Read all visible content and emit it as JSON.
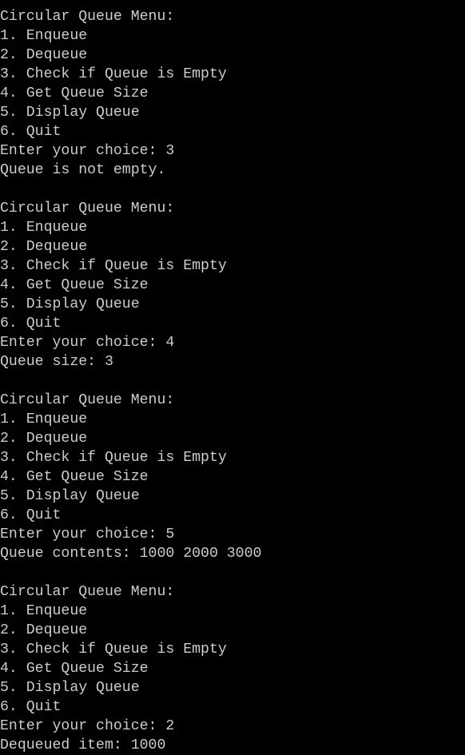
{
  "window": {
    "colors": {
      "background": "#000000",
      "text": "#cccccc"
    }
  },
  "terminal": {
    "blocks": [
      {
        "menu_title": "Circular Queue Menu:",
        "options": [
          "1. Enqueue",
          "2. Dequeue",
          "3. Check if Queue is Empty",
          "4. Get Queue Size",
          "5. Display Queue",
          "6. Quit"
        ],
        "prompt": "Enter your choice: 3",
        "output": "Queue is not empty."
      },
      {
        "menu_title": "Circular Queue Menu:",
        "options": [
          "1. Enqueue",
          "2. Dequeue",
          "3. Check if Queue is Empty",
          "4. Get Queue Size",
          "5. Display Queue",
          "6. Quit"
        ],
        "prompt": "Enter your choice: 4",
        "output": "Queue size: 3"
      },
      {
        "menu_title": "Circular Queue Menu:",
        "options": [
          "1. Enqueue",
          "2. Dequeue",
          "3. Check if Queue is Empty",
          "4. Get Queue Size",
          "5. Display Queue",
          "6. Quit"
        ],
        "prompt": "Enter your choice: 5",
        "output": "Queue contents: 1000 2000 3000"
      },
      {
        "menu_title": "Circular Queue Menu:",
        "options": [
          "1. Enqueue",
          "2. Dequeue",
          "3. Check if Queue is Empty",
          "4. Get Queue Size",
          "5. Display Queue",
          "6. Quit"
        ],
        "prompt": "Enter your choice: 2",
        "output": "Dequeued item: 1000"
      }
    ]
  }
}
